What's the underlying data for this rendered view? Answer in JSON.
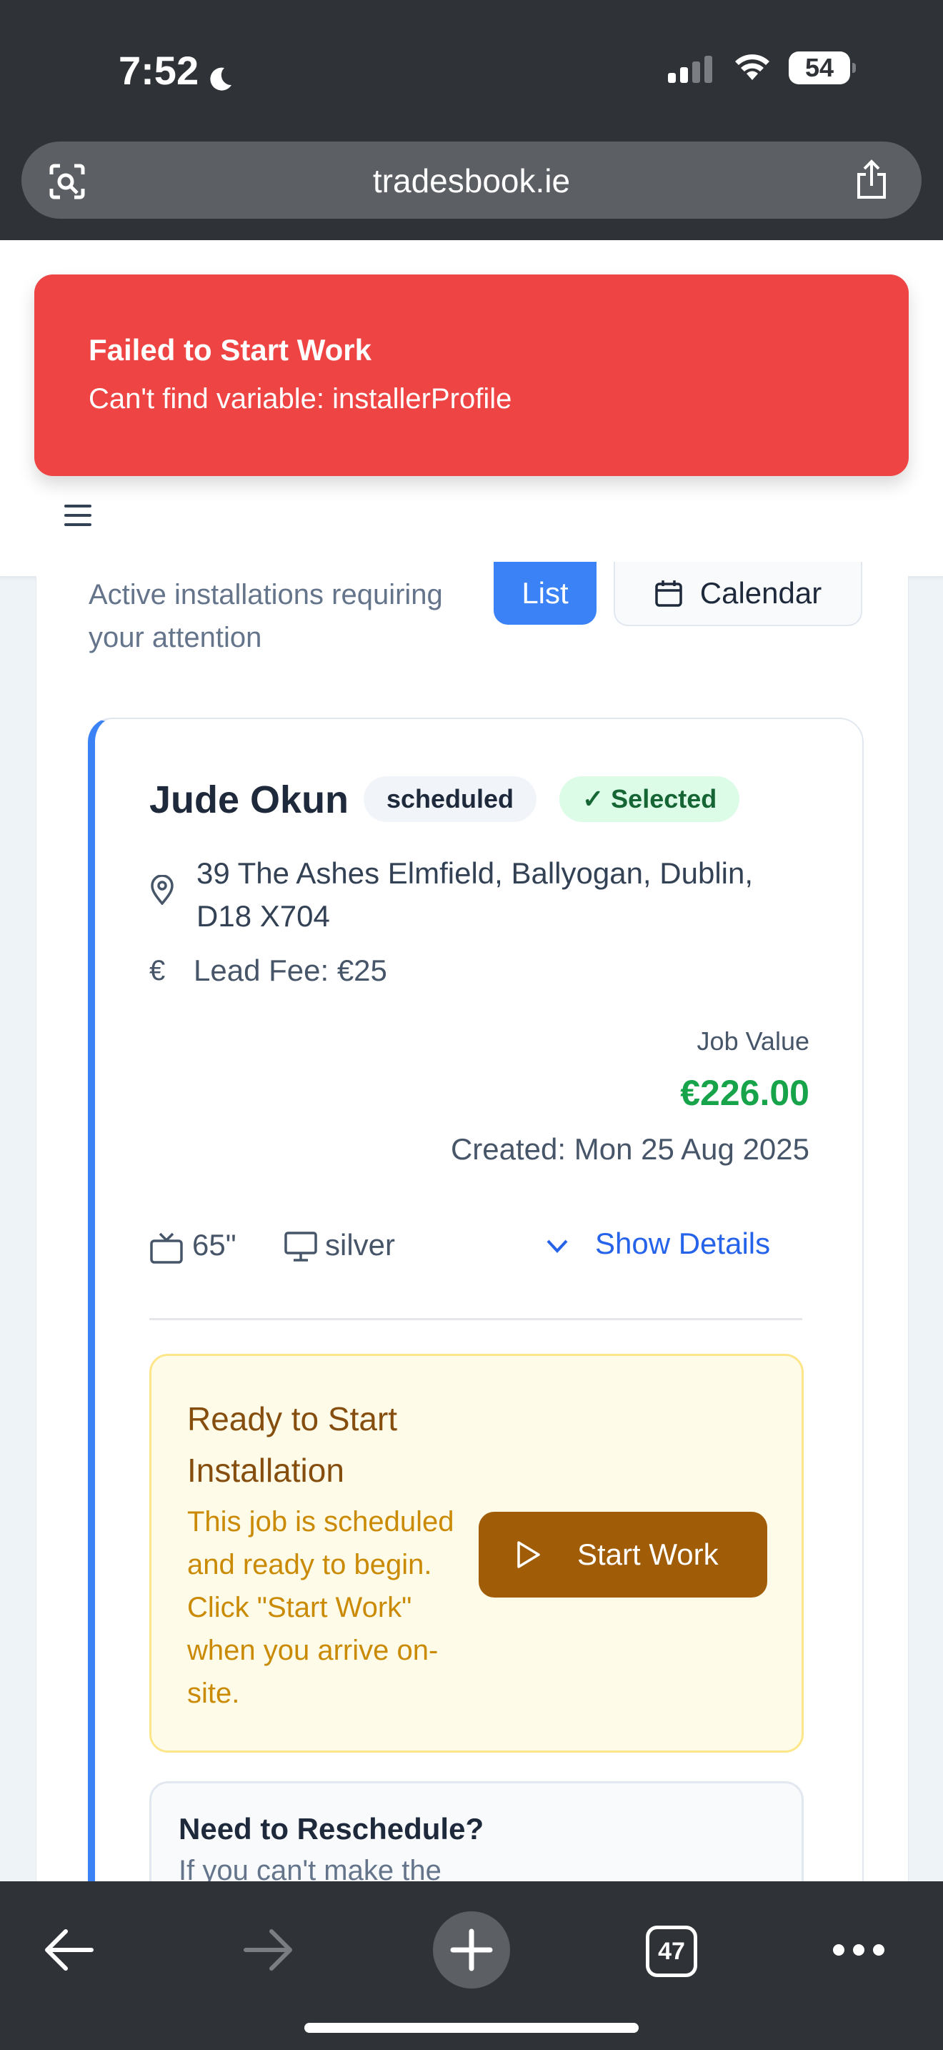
{
  "status_bar": {
    "time": "7:52",
    "battery": "54"
  },
  "browser": {
    "url": "tradesbook.ie",
    "tab_count": "47"
  },
  "toast": {
    "title": "Failed to Start Work",
    "message": "Can't find variable: installerProfile"
  },
  "page": {
    "subtitle": "Active installations requiring your attention",
    "view_list_label": "List",
    "view_calendar_label": "Calendar"
  },
  "job": {
    "customer_name": "Jude Okun",
    "status": "scheduled",
    "selected_label": "Selected",
    "address": "39 The Ashes Elmfield, Ballyogan, Dublin, D18 X704",
    "lead_fee": "Lead Fee: €25",
    "job_value_label": "Job Value",
    "job_value": "€226.00",
    "created": "Created: Mon 25 Aug 2025",
    "tv_size": "65\"",
    "tv_color": "silver",
    "show_details_label": "Show Details"
  },
  "ready": {
    "title": "Ready to Start Installation",
    "description": "This job is scheduled and ready to begin. Click \"Start Work\" when you arrive on-site.",
    "start_button": "Start Work"
  },
  "reschedule": {
    "title": "Need to Reschedule?",
    "text": "If you can't make the"
  },
  "colors": {
    "accent": "#3b82f6",
    "toast_red": "#ef4444",
    "job_value_green": "#16a34a",
    "start_button": "#a15c07"
  }
}
